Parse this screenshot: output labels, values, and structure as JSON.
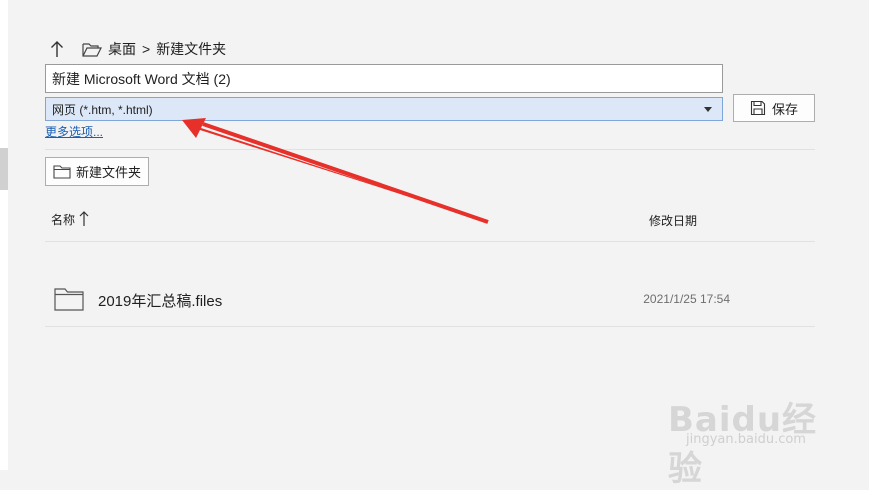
{
  "breadcrumb": {
    "items": [
      "桌面",
      "新建文件夹"
    ],
    "separator": ">"
  },
  "filename": {
    "value": "新建 Microsoft Word 文档 (2)"
  },
  "file_type": {
    "selected": "网页 (*.htm, *.html)"
  },
  "save_button": {
    "label": "保存"
  },
  "more_options": {
    "label": "更多选项..."
  },
  "new_folder_button": {
    "label": "新建文件夹"
  },
  "columns": {
    "name": "名称",
    "date": "修改日期"
  },
  "files": [
    {
      "name": "2019年汇总稿.files",
      "date": "2021/1/25 17:54",
      "icon": "folder-icon"
    }
  ],
  "annotation": {
    "color": "#e8302a"
  },
  "watermark": {
    "brand": "Baidu经验",
    "url": "jingyan.baidu.com"
  },
  "icons": [
    "arrow-up-icon",
    "folder-open-icon",
    "save-icon",
    "chevron-down-icon",
    "folder-icon",
    "sort-ascending-icon"
  ]
}
